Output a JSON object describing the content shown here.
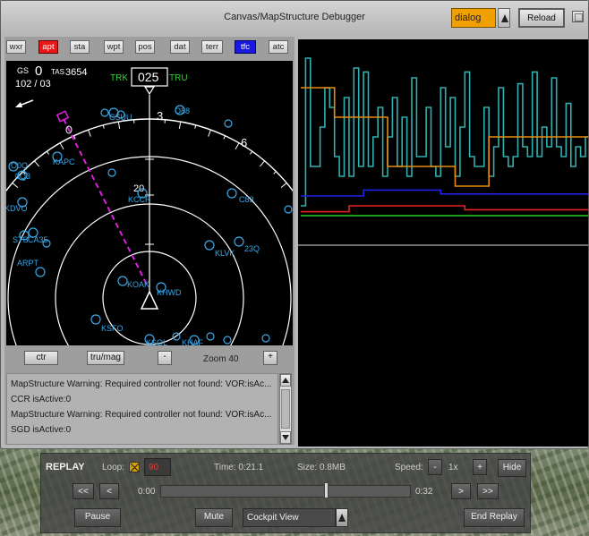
{
  "window": {
    "title": "Canvas/MapStructure Debugger",
    "dialog_select": "dialog",
    "reload_label": "Reload"
  },
  "layers": [
    {
      "id": "wxr",
      "label": "wxr",
      "active": false
    },
    {
      "id": "apt",
      "label": "apt",
      "active": true
    },
    {
      "id": "sta",
      "label": "sta",
      "active": false
    },
    {
      "id": "wpt",
      "label": "wpt",
      "active": false
    },
    {
      "id": "pos",
      "label": "pos",
      "active": false
    },
    {
      "id": "dat",
      "label": "dat",
      "active": false
    },
    {
      "id": "terr",
      "label": "terr",
      "active": false
    },
    {
      "id": "tfc",
      "label": "tfc",
      "active": true
    },
    {
      "id": "atc",
      "label": "atc",
      "active": false
    }
  ],
  "map": {
    "gs_label": "GS",
    "gs_value": "0",
    "tas_label": "TAS",
    "tas_value": "3654",
    "wind": "102 / 03",
    "trk_label": "TRK",
    "heading": "025",
    "tru_label": "TRU",
    "compass_labels": [
      "3",
      "6"
    ],
    "range_label": "20",
    "stations": [
      "KSFO",
      "KHWD",
      "KOAK",
      "KCCR",
      "KAPC",
      "KLVK",
      "C83",
      "23Q",
      "O88",
      "O0Q",
      "0Q3",
      "KDVO",
      "STS",
      "CA35",
      "ARPT",
      "KSQL",
      "KHAF",
      "CSUU"
    ],
    "colors": {
      "station": "#3aa8e8",
      "route": "#e020e0",
      "ring": "#ffffff",
      "trk": "#30d030"
    }
  },
  "map_controls": {
    "ctr_label": "ctr",
    "trumag_label": "tru/mag",
    "zoom_out_label": "-",
    "zoom_in_label": "+",
    "zoom_label": "Zoom 40"
  },
  "log": [
    "MapStructure Warning: Required controller not found: VOR:isAc...",
    "CCR isActive:0",
    "MapStructure Warning: Required controller not found: VOR:isAc...",
    "SGD isActive:0"
  ],
  "replay": {
    "title": "REPLAY",
    "loop_label": "Loop:",
    "loop_value": "90",
    "time_label": "Time: 0:21.1",
    "size_label": "Size: 0.8MB",
    "speed_label": "Speed:",
    "speed_value": "1x",
    "speed_minus": "-",
    "speed_plus": "+",
    "hide_label": "Hide",
    "rewind_fast": "<<",
    "rewind": "<",
    "start_time": "0:00",
    "end_time": "0:32",
    "position_fraction": 0.66,
    "forward": ">",
    "forward_fast": ">>",
    "pause_label": "Pause",
    "mute_label": "Mute",
    "view_value": "Cockpit View",
    "end_replay_label": "End Replay"
  },
  "chart_data": {
    "type": "line",
    "x": [
      0,
      1,
      2,
      3,
      4,
      5,
      6,
      7,
      8,
      9,
      10,
      11,
      12,
      13,
      14,
      15,
      16,
      17,
      18,
      19,
      20,
      21,
      22,
      23,
      24,
      25,
      26,
      27,
      28,
      29,
      30,
      31,
      32,
      33,
      34,
      35,
      36,
      37,
      38,
      39,
      40,
      41,
      42,
      43,
      44,
      45,
      46,
      47,
      48,
      49,
      50,
      51,
      52,
      53,
      54,
      55,
      56,
      57,
      58,
      59
    ],
    "ylim": [
      0,
      100
    ],
    "series": [
      {
        "color": "#30b0b0",
        "values": [
          20,
          95,
          40,
          40,
          60,
          80,
          70,
          45,
          35,
          75,
          35,
          90,
          40,
          88,
          40,
          55,
          70,
          35,
          55,
          75,
          40,
          65,
          35,
          85,
          45,
          45,
          70,
          40,
          35,
          80,
          50,
          75,
          35,
          60,
          88,
          45,
          40,
          40,
          70,
          35,
          50,
          80,
          45,
          40,
          45,
          82,
          50,
          45,
          88,
          45,
          60,
          50,
          85,
          50,
          45,
          72,
          40,
          50,
          45,
          55
        ]
      },
      {
        "color": "#e88a10",
        "values": [
          80,
          80,
          80,
          80,
          80,
          80,
          80,
          65,
          65,
          65,
          65,
          65,
          65,
          65,
          65,
          65,
          65,
          65,
          40,
          40,
          40,
          40,
          40,
          40,
          40,
          40,
          40,
          40,
          40,
          40,
          40,
          40,
          30,
          30,
          30,
          30,
          30,
          30,
          30,
          55,
          55,
          55,
          55,
          55,
          55,
          55,
          55,
          55,
          55,
          55,
          55,
          55,
          55,
          55,
          55,
          55,
          55,
          55,
          55,
          55
        ]
      },
      {
        "color": "#2020e8",
        "values": [
          25,
          25,
          25,
          25,
          25,
          25,
          25,
          25,
          25,
          25,
          25,
          25,
          25,
          28,
          28,
          28,
          28,
          28,
          28,
          28,
          28,
          28,
          28,
          28,
          28,
          28,
          28,
          28,
          28,
          26,
          26,
          26,
          26,
          26,
          26,
          26,
          26,
          26,
          26,
          26,
          26,
          26,
          26,
          26,
          26,
          26,
          26,
          26,
          26,
          26,
          26,
          26,
          26,
          26,
          26,
          26,
          26,
          26,
          26,
          26
        ]
      },
      {
        "color": "#e82020",
        "values": [
          17,
          17,
          17,
          17,
          17,
          17,
          17,
          17,
          17,
          17,
          20,
          20,
          20,
          20,
          20,
          20,
          20,
          20,
          20,
          20,
          20,
          20,
          20,
          20,
          20,
          20,
          20,
          20,
          20,
          20,
          20,
          20,
          20,
          20,
          18,
          18,
          18,
          18,
          18,
          18,
          18,
          18,
          18,
          18,
          18,
          18,
          18,
          18,
          18,
          18,
          18,
          18,
          18,
          18,
          18,
          18,
          18,
          18,
          18,
          18
        ]
      },
      {
        "color": "#20d020",
        "values": [
          15,
          15,
          15,
          15,
          15,
          15,
          15,
          15,
          15,
          15,
          15,
          15,
          15,
          15,
          15,
          15,
          15,
          15,
          15,
          15,
          15,
          15,
          15,
          15,
          15,
          15,
          15,
          15,
          15,
          15,
          15,
          15,
          15,
          15,
          15,
          15,
          15,
          15,
          15,
          15,
          15,
          15,
          15,
          15,
          15,
          15,
          15,
          15,
          15,
          15,
          15,
          15,
          15,
          15,
          15,
          15,
          15,
          15,
          15,
          15
        ]
      }
    ]
  }
}
